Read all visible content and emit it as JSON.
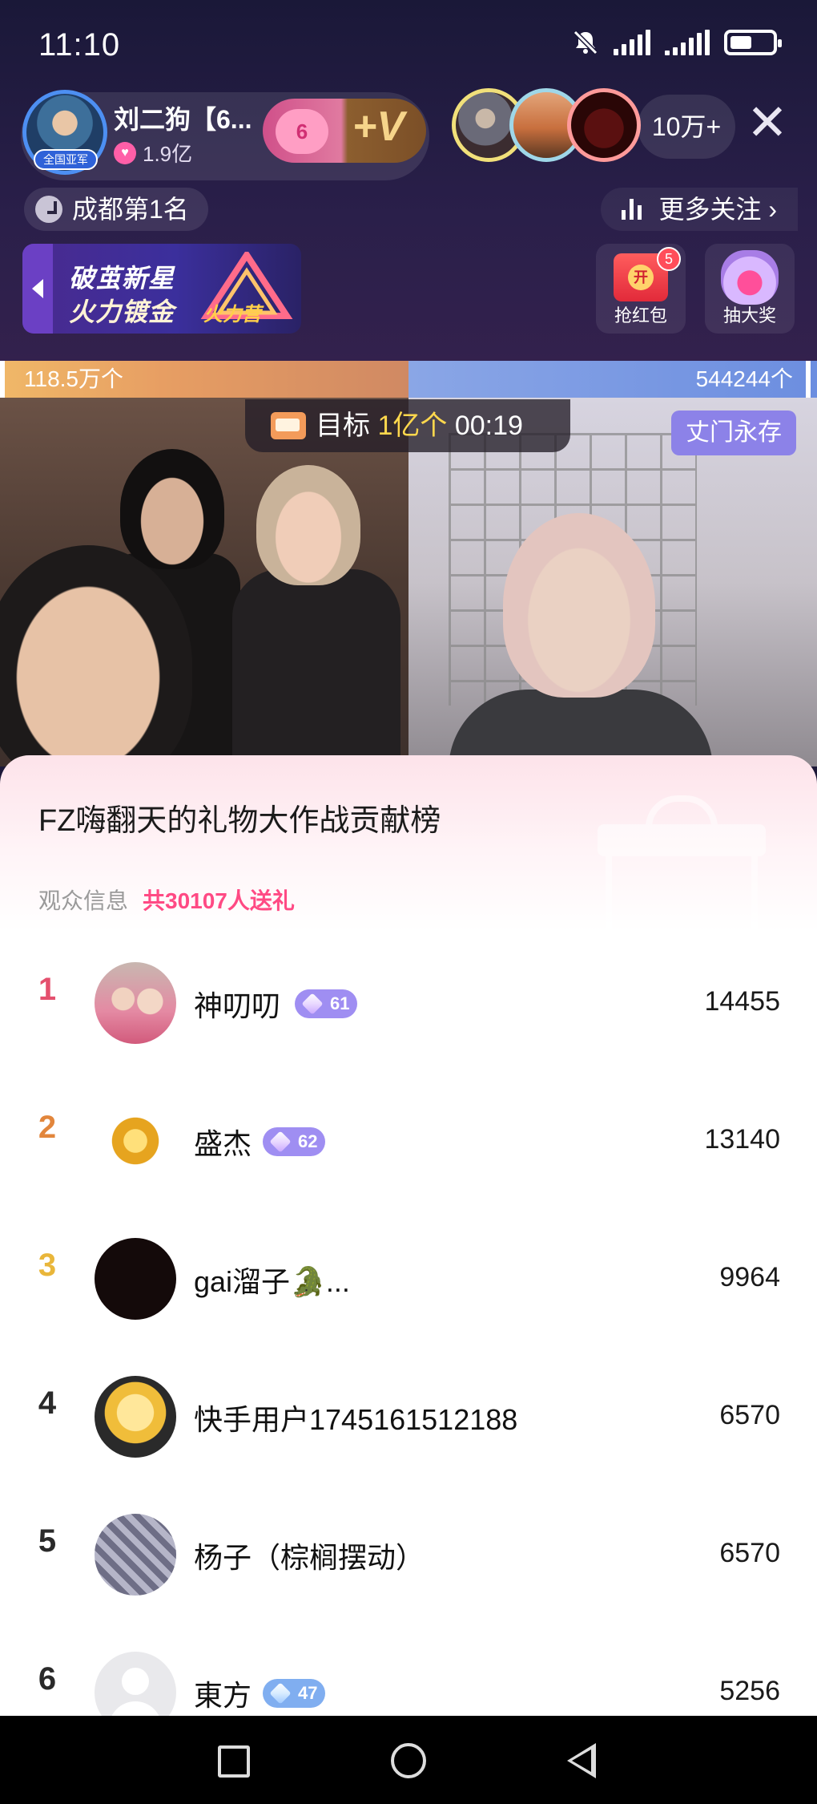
{
  "status_bar": {
    "time": "11:10"
  },
  "anchor": {
    "name": "刘二狗【6...",
    "heat": "1.9亿",
    "badge": "全国亚军",
    "fan_level": "6",
    "fan_plus": "+V"
  },
  "viewers": {
    "count": "10万+"
  },
  "location_rank": "成都第1名",
  "more_follow": "更多关注 ›",
  "banner": {
    "line1": "破茧新星",
    "line2": "火力镀金",
    "logo_text": "火力营"
  },
  "activities": {
    "red_packet": {
      "label": "抢红包",
      "count": "5",
      "icon_text": "开"
    },
    "lottery": {
      "label": "抽大奖"
    }
  },
  "pk": {
    "left_score": "118.5万个",
    "right_score": "544244个",
    "target_label": "目标",
    "target_amount": "1亿个",
    "target_time": "00:19",
    "right_team_tag": "丈门永存"
  },
  "contribution": {
    "title": "FZ嗨翻天的礼物大作战贡献榜",
    "subtitle": "观众信息",
    "total": "共30107人送礼",
    "rows": [
      {
        "rank": "1",
        "name": "神叨叨",
        "level": "61",
        "level_color": "purple",
        "score": "14455"
      },
      {
        "rank": "2",
        "name": "盛杰",
        "level": "62",
        "level_color": "purple",
        "score": "13140"
      },
      {
        "rank": "3",
        "name": "gai溜子🐊...",
        "level": "",
        "score": "9964"
      },
      {
        "rank": "4",
        "name": "快手用户1745161512188",
        "level": "",
        "score": "6570"
      },
      {
        "rank": "5",
        "name": "杨子（棕榈摆动）",
        "level": "",
        "score": "6570"
      },
      {
        "rank": "6",
        "name": "東方",
        "level": "47",
        "level_color": "blue",
        "score": "5256"
      }
    ]
  },
  "icons": {
    "status": [
      "mute-bell-icon",
      "signal-icon",
      "signal-icon",
      "battery-icon"
    ],
    "nav": [
      "recents-icon",
      "home-icon",
      "back-icon"
    ]
  }
}
